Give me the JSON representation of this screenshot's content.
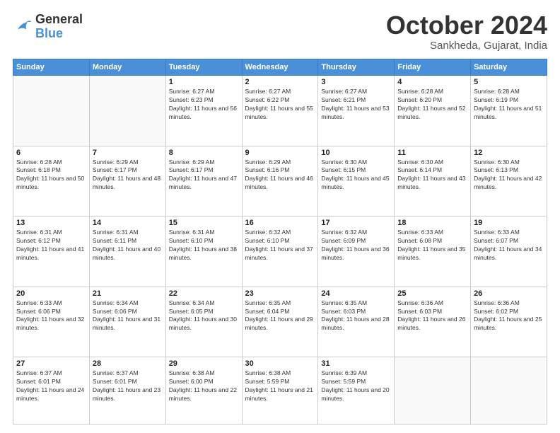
{
  "header": {
    "logo_line1": "General",
    "logo_line2": "Blue",
    "month": "October 2024",
    "location": "Sankheda, Gujarat, India"
  },
  "weekdays": [
    "Sunday",
    "Monday",
    "Tuesday",
    "Wednesday",
    "Thursday",
    "Friday",
    "Saturday"
  ],
  "weeks": [
    [
      {
        "day": "",
        "info": ""
      },
      {
        "day": "",
        "info": ""
      },
      {
        "day": "1",
        "info": "Sunrise: 6:27 AM\nSunset: 6:23 PM\nDaylight: 11 hours and 56 minutes."
      },
      {
        "day": "2",
        "info": "Sunrise: 6:27 AM\nSunset: 6:22 PM\nDaylight: 11 hours and 55 minutes."
      },
      {
        "day": "3",
        "info": "Sunrise: 6:27 AM\nSunset: 6:21 PM\nDaylight: 11 hours and 53 minutes."
      },
      {
        "day": "4",
        "info": "Sunrise: 6:28 AM\nSunset: 6:20 PM\nDaylight: 11 hours and 52 minutes."
      },
      {
        "day": "5",
        "info": "Sunrise: 6:28 AM\nSunset: 6:19 PM\nDaylight: 11 hours and 51 minutes."
      }
    ],
    [
      {
        "day": "6",
        "info": "Sunrise: 6:28 AM\nSunset: 6:18 PM\nDaylight: 11 hours and 50 minutes."
      },
      {
        "day": "7",
        "info": "Sunrise: 6:29 AM\nSunset: 6:17 PM\nDaylight: 11 hours and 48 minutes."
      },
      {
        "day": "8",
        "info": "Sunrise: 6:29 AM\nSunset: 6:17 PM\nDaylight: 11 hours and 47 minutes."
      },
      {
        "day": "9",
        "info": "Sunrise: 6:29 AM\nSunset: 6:16 PM\nDaylight: 11 hours and 46 minutes."
      },
      {
        "day": "10",
        "info": "Sunrise: 6:30 AM\nSunset: 6:15 PM\nDaylight: 11 hours and 45 minutes."
      },
      {
        "day": "11",
        "info": "Sunrise: 6:30 AM\nSunset: 6:14 PM\nDaylight: 11 hours and 43 minutes."
      },
      {
        "day": "12",
        "info": "Sunrise: 6:30 AM\nSunset: 6:13 PM\nDaylight: 11 hours and 42 minutes."
      }
    ],
    [
      {
        "day": "13",
        "info": "Sunrise: 6:31 AM\nSunset: 6:12 PM\nDaylight: 11 hours and 41 minutes."
      },
      {
        "day": "14",
        "info": "Sunrise: 6:31 AM\nSunset: 6:11 PM\nDaylight: 11 hours and 40 minutes."
      },
      {
        "day": "15",
        "info": "Sunrise: 6:31 AM\nSunset: 6:10 PM\nDaylight: 11 hours and 38 minutes."
      },
      {
        "day": "16",
        "info": "Sunrise: 6:32 AM\nSunset: 6:10 PM\nDaylight: 11 hours and 37 minutes."
      },
      {
        "day": "17",
        "info": "Sunrise: 6:32 AM\nSunset: 6:09 PM\nDaylight: 11 hours and 36 minutes."
      },
      {
        "day": "18",
        "info": "Sunrise: 6:33 AM\nSunset: 6:08 PM\nDaylight: 11 hours and 35 minutes."
      },
      {
        "day": "19",
        "info": "Sunrise: 6:33 AM\nSunset: 6:07 PM\nDaylight: 11 hours and 34 minutes."
      }
    ],
    [
      {
        "day": "20",
        "info": "Sunrise: 6:33 AM\nSunset: 6:06 PM\nDaylight: 11 hours and 32 minutes."
      },
      {
        "day": "21",
        "info": "Sunrise: 6:34 AM\nSunset: 6:06 PM\nDaylight: 11 hours and 31 minutes."
      },
      {
        "day": "22",
        "info": "Sunrise: 6:34 AM\nSunset: 6:05 PM\nDaylight: 11 hours and 30 minutes."
      },
      {
        "day": "23",
        "info": "Sunrise: 6:35 AM\nSunset: 6:04 PM\nDaylight: 11 hours and 29 minutes."
      },
      {
        "day": "24",
        "info": "Sunrise: 6:35 AM\nSunset: 6:03 PM\nDaylight: 11 hours and 28 minutes."
      },
      {
        "day": "25",
        "info": "Sunrise: 6:36 AM\nSunset: 6:03 PM\nDaylight: 11 hours and 26 minutes."
      },
      {
        "day": "26",
        "info": "Sunrise: 6:36 AM\nSunset: 6:02 PM\nDaylight: 11 hours and 25 minutes."
      }
    ],
    [
      {
        "day": "27",
        "info": "Sunrise: 6:37 AM\nSunset: 6:01 PM\nDaylight: 11 hours and 24 minutes."
      },
      {
        "day": "28",
        "info": "Sunrise: 6:37 AM\nSunset: 6:01 PM\nDaylight: 11 hours and 23 minutes."
      },
      {
        "day": "29",
        "info": "Sunrise: 6:38 AM\nSunset: 6:00 PM\nDaylight: 11 hours and 22 minutes."
      },
      {
        "day": "30",
        "info": "Sunrise: 6:38 AM\nSunset: 5:59 PM\nDaylight: 11 hours and 21 minutes."
      },
      {
        "day": "31",
        "info": "Sunrise: 6:39 AM\nSunset: 5:59 PM\nDaylight: 11 hours and 20 minutes."
      },
      {
        "day": "",
        "info": ""
      },
      {
        "day": "",
        "info": ""
      }
    ]
  ]
}
